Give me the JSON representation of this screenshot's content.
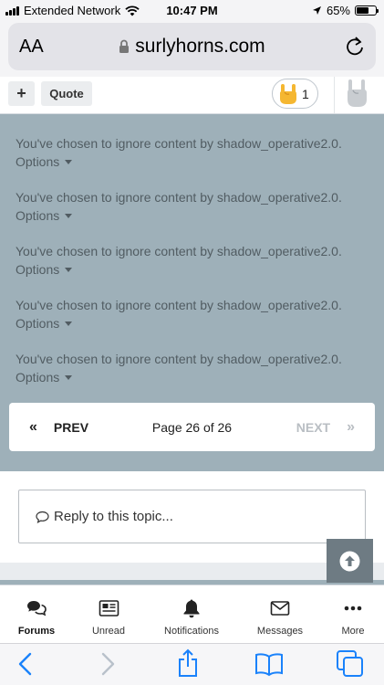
{
  "status_bar": {
    "carrier": "Extended Network",
    "time": "10:47 PM",
    "battery_percent": "65%",
    "battery_level": 0.65
  },
  "browser": {
    "text_size_label": "AA",
    "url": "surlyhorns.com"
  },
  "post_toolbar": {
    "plus_label": "+",
    "quote_label": "Quote",
    "reaction_count": "1"
  },
  "ignored_posts": [
    {
      "message": "You've chosen to ignore content by shadow_operative2.0.",
      "options_label": "Options"
    },
    {
      "message": "You've chosen to ignore content by shadow_operative2.0.",
      "options_label": "Options"
    },
    {
      "message": "You've chosen to ignore content by shadow_operative2.0.",
      "options_label": "Options"
    },
    {
      "message": "You've chosen to ignore content by shadow_operative2.0.",
      "options_label": "Options"
    },
    {
      "message": "You've chosen to ignore content by shadow_operative2.0.",
      "options_label": "Options"
    }
  ],
  "pagination": {
    "prev_label": "PREV",
    "page_info": "Page 26 of 26",
    "next_label": "NEXT"
  },
  "reply": {
    "placeholder": "Reply to this topic..."
  },
  "bottom_nav": {
    "items": [
      {
        "label": "Forums",
        "icon": "forums-icon",
        "active": true
      },
      {
        "label": "Unread",
        "icon": "unread-icon",
        "active": false
      },
      {
        "label": "Notifications",
        "icon": "bell-icon",
        "active": false
      },
      {
        "label": "Messages",
        "icon": "envelope-icon",
        "active": false
      },
      {
        "label": "More",
        "icon": "more-icon",
        "active": false
      }
    ]
  },
  "colors": {
    "ignored_bg": "#9eb0b9",
    "ios_blue": "#1a82fb",
    "scroll_top_bg": "#6e7b83"
  }
}
